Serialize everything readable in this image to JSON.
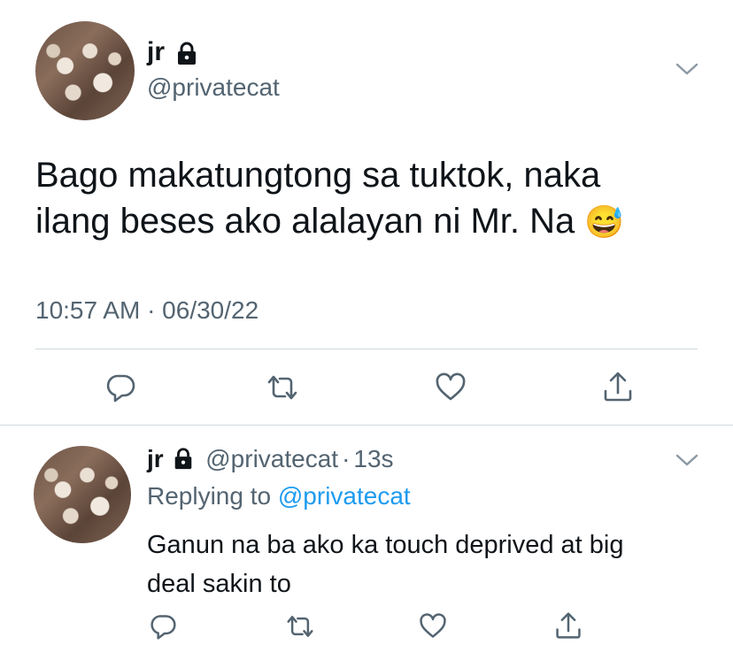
{
  "main_tweet": {
    "display_name": "jr",
    "handle": "@privatecat",
    "text_line1": "Bago makatungtong sa tuktok, naka",
    "text_line2": "ilang beses ako alalayan ni Mr. Na",
    "emoji": "😅",
    "timestamp": "10:57 AM · 06/30/22"
  },
  "reply_tweet": {
    "display_name": "jr",
    "handle": "@privatecat",
    "separator": "·",
    "time": "13s",
    "replying_prefix": "Replying to",
    "replying_to": "@privatecat",
    "text_line1": "Ganun na ba ako ka touch deprived at big",
    "text_line2": "deal sakin to"
  },
  "icons": {
    "lock": "lock-icon",
    "more": "chevron-down-icon",
    "reply": "reply-icon",
    "retweet": "retweet-icon",
    "like": "heart-icon",
    "share": "share-icon"
  },
  "colors": {
    "text": "#0f1419",
    "secondary": "#536471",
    "link": "#1d9bf0",
    "divider": "#cfd9de"
  }
}
